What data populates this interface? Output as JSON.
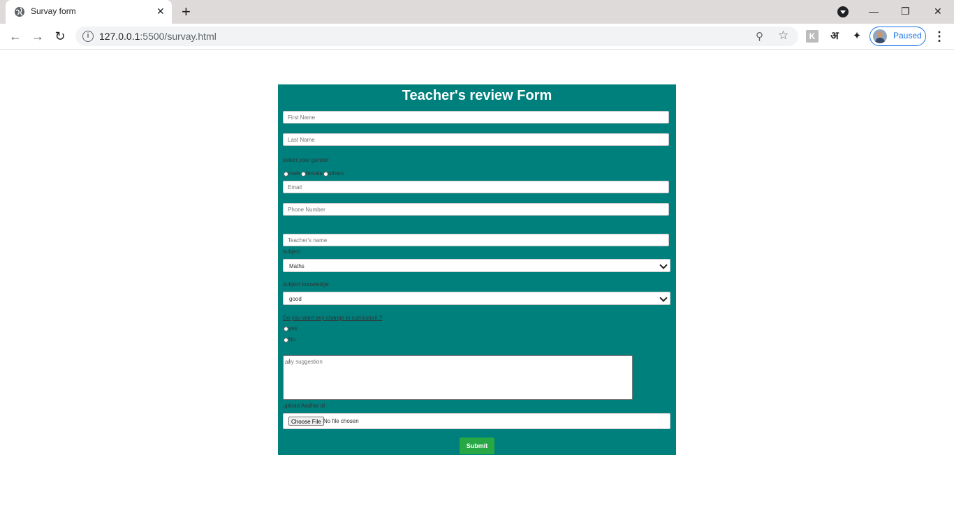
{
  "browser": {
    "tab_title": "Survay form",
    "tab_close": "✕",
    "new_tab": "+",
    "url_host": "127.0.0.1",
    "url_rest": ":5500/survay.html",
    "profile_label": "Paused",
    "ext_hindi": "अ",
    "ext_k": "K",
    "window_minimize": "—",
    "window_restore": "❐",
    "window_close": "✕",
    "menu": "⋮",
    "back": "←",
    "forward": "→",
    "reload": "↻",
    "zoom_icon": "⚲",
    "star_icon": "☆",
    "puzzle_icon": "✦",
    "info_icon": "i"
  },
  "form": {
    "title": "Teacher's review Form",
    "first_name_placeholder": "First Name",
    "last_name_placeholder": "Last Name",
    "gender_label": "select your gender",
    "gender_options": [
      "male",
      "female",
      "others"
    ],
    "email_placeholder": "Email",
    "phone_placeholder": "Phone Number",
    "teacher_placeholder": "Teacher's name",
    "subject_label": "subject",
    "subject_value": "Maths",
    "knowledge_label": "subject knowledge",
    "knowledge_value": "good",
    "curriculum_question": "Do you want any change in curriculum ?",
    "curriculum_options": [
      "yes",
      "No"
    ],
    "suggestion_placeholder": "any suggestion",
    "upload_label": "upload Aadhar id",
    "file_button": "Choose File",
    "file_status": "No file chosen",
    "submit_label": "Submit"
  },
  "colors": {
    "form_bg": "#00807d",
    "submit_bg": "#28a745"
  }
}
